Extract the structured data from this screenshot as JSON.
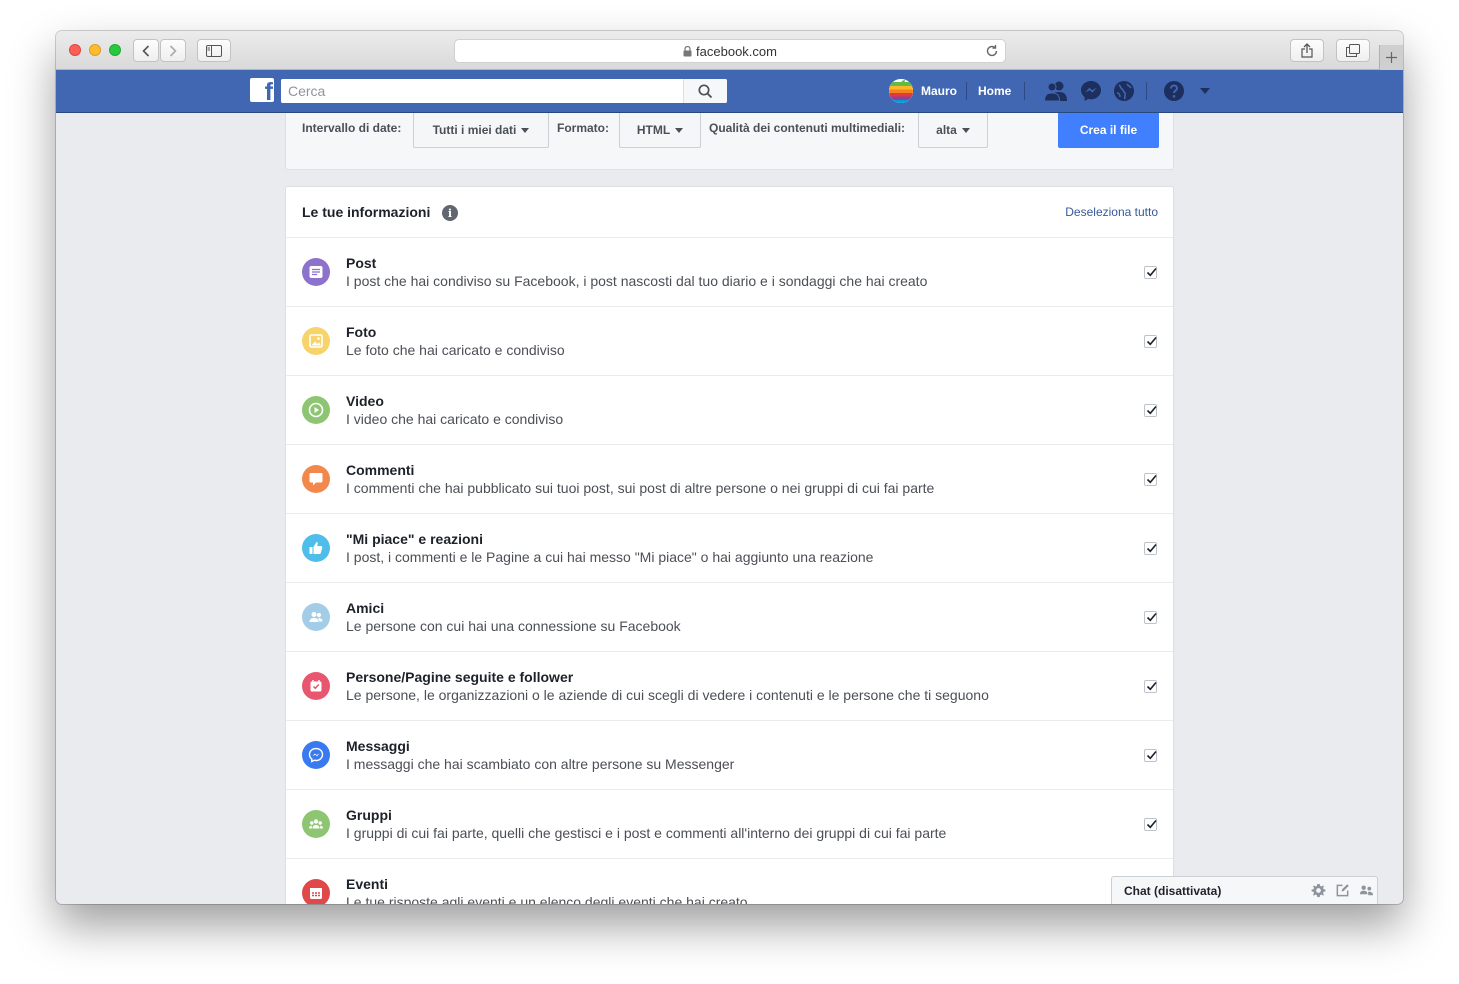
{
  "browser": {
    "url": "facebook.com"
  },
  "header": {
    "search_placeholder": "Cerca",
    "user_name": "Mauro",
    "home_label": "Home"
  },
  "filters": {
    "date_label": "Intervallo di date:",
    "date_value": "Tutti i miei dati",
    "format_label": "Formato:",
    "format_value": "HTML",
    "quality_label": "Qualità dei contenuti multimediali:",
    "quality_value": "alta",
    "create_label": "Crea il file"
  },
  "info": {
    "title": "Le tue informazioni",
    "deselect_label": "Deseleziona tutto",
    "items": [
      {
        "title": "Post",
        "desc": "I post che hai condiviso su Facebook, i post nascosti dal tuo diario e i sondaggi che hai creato",
        "icon": "post-icon",
        "color": "#8c72cb"
      },
      {
        "title": "Foto",
        "desc": "Le foto che hai caricato e condiviso",
        "icon": "photo-icon",
        "color": "#f7d36c"
      },
      {
        "title": "Video",
        "desc": "I video che hai caricato e condiviso",
        "icon": "video-icon",
        "color": "#8dc572"
      },
      {
        "title": "Commenti",
        "desc": "I commenti che hai pubblicato sui tuoi post, sui post di altre persone o nei gruppi di cui fai parte",
        "icon": "comment-icon",
        "color": "#f2884b"
      },
      {
        "title": "\"Mi piace\" e reazioni",
        "desc": "I post, i commenti e le Pagine a cui hai messo \"Mi piace\" o hai aggiunto una reazione",
        "icon": "like-icon",
        "color": "#4fbde9"
      },
      {
        "title": "Amici",
        "desc": "Le persone con cui hai una connessione su Facebook",
        "icon": "friends-icon",
        "color": "#a3cce6"
      },
      {
        "title": "Persone/Pagine seguite e follower",
        "desc": "Le persone, le organizzazioni o le aziende di cui scegli di vedere i contenuti e le persone che ti seguono",
        "icon": "follow-icon",
        "color": "#e8566f"
      },
      {
        "title": "Messaggi",
        "desc": "I messaggi che hai scambiato con altre persone su Messenger",
        "icon": "messenger-icon",
        "color": "#3a7af0"
      },
      {
        "title": "Gruppi",
        "desc": "I gruppi di cui fai parte, quelli che gestisci e i post e commenti all'interno dei gruppi di cui fai parte",
        "icon": "groups-icon",
        "color": "#8dc572"
      },
      {
        "title": "Eventi",
        "desc": "Le tue risposte agli eventi e un elenco degli eventi che hai creato",
        "icon": "events-icon",
        "color": "#e0484a"
      }
    ]
  },
  "chat": {
    "label": "Chat (disattivata)"
  }
}
